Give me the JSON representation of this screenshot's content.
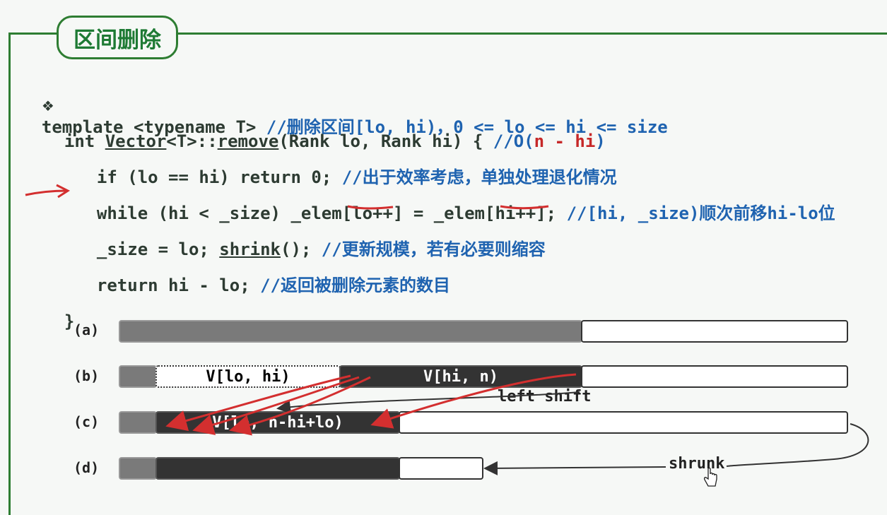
{
  "title": "区间删除",
  "code": {
    "l1_bullet": "❖",
    "l1_a": "template <typename T> ",
    "l1_comment": "//删除区间[lo, hi)，0 <= lo <= hi <= size",
    "l2_a": "int ",
    "l2_vector": "Vector",
    "l2_b": "<T>::",
    "l2_remove": "remove",
    "l2_c": "(Rank lo, Rank hi) { ",
    "l2_comment_a": "//O(",
    "l2_comment_red": "n - hi",
    "l2_comment_b": ")",
    "l3_a": "if (lo == hi) return 0; ",
    "l3_comment": "//出于效率考虑，单独处理退化情况",
    "l4_a": "while (hi < _size) _elem[",
    "l4_lo": "lo++",
    "l4_b": "] = _elem[",
    "l4_hi": "hi++",
    "l4_c": "]; ",
    "l4_comment": "//[hi, _size)顺次前移hi-lo位",
    "l5_a": "_size = lo; ",
    "l5_shrink": "shrink",
    "l5_b": "(); ",
    "l5_comment": "//更新规模，若有必要则缩容",
    "l6_a": "return hi - lo; ",
    "l6_comment": "//返回被删除元素的数目",
    "l7": "}"
  },
  "diagram": {
    "rows": [
      "(a)",
      "(b)",
      "(c)",
      "(d)"
    ],
    "b_deleted_label": "V[lo, hi)",
    "b_moved_label": "V[hi, n)",
    "c_result_label": "V[lo, n-hi+lo)",
    "left_shift_label": "left shift",
    "shrunk_label": "shrunk"
  },
  "colors": {
    "frame": "#2e7d32",
    "comment": "#1f63b0",
    "highlight": "#c62828",
    "annotation_ink": "#d32f2f"
  },
  "icons": [
    "bullet-diamond-icon",
    "hand-cursor-icon"
  ]
}
